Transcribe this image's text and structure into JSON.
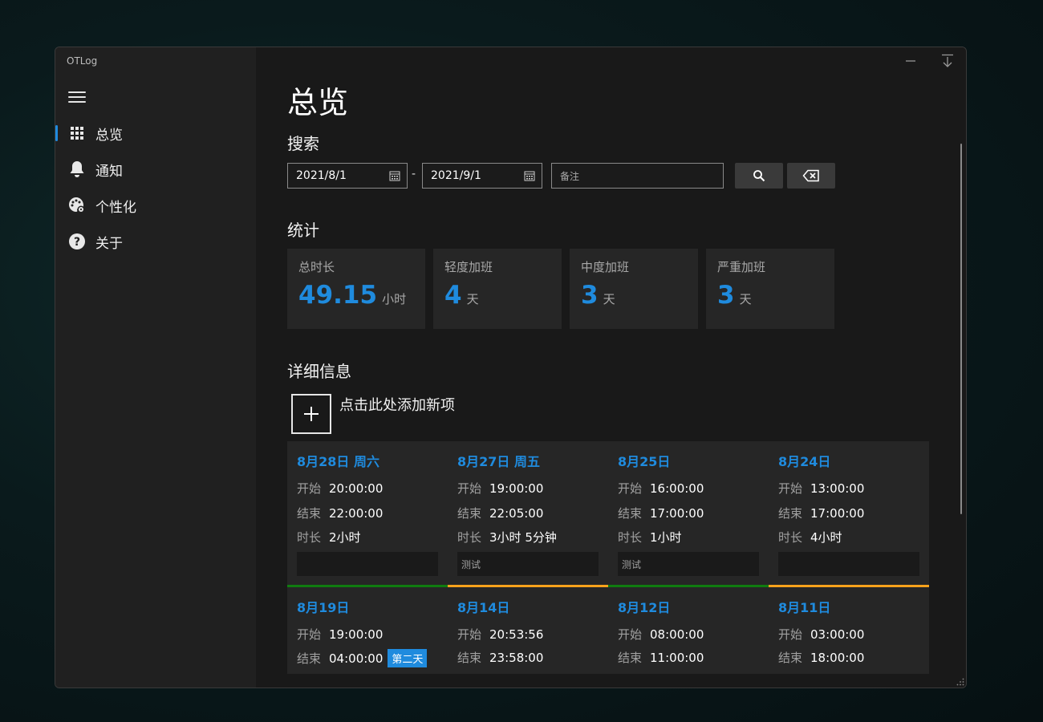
{
  "app": {
    "title": "OTLog"
  },
  "sidebar": {
    "items": [
      {
        "label": "总览",
        "icon": "grid-icon",
        "active": true
      },
      {
        "label": "通知",
        "icon": "bell-icon",
        "active": false
      },
      {
        "label": "个性化",
        "icon": "palette-icon",
        "active": false
      },
      {
        "label": "关于",
        "icon": "help-icon",
        "active": false
      }
    ]
  },
  "page": {
    "title": "总览"
  },
  "search": {
    "title": "搜索",
    "start_date": "2021/8/1",
    "end_date": "2021/9/1",
    "separator": "-",
    "note_placeholder": "备注"
  },
  "stats": {
    "title": "统计",
    "cards": [
      {
        "title": "总时长",
        "value": "49.15",
        "unit": "小时"
      },
      {
        "title": "轻度加班",
        "value": "4",
        "unit": "天"
      },
      {
        "title": "中度加班",
        "value": "3",
        "unit": "天"
      },
      {
        "title": "严重加班",
        "value": "3",
        "unit": "天"
      }
    ]
  },
  "details": {
    "title": "详细信息",
    "add_label": "点击此处添加新项",
    "labels": {
      "start": "开始",
      "end": "结束",
      "duration": "时长"
    },
    "entries": [
      {
        "date": "8月28日 周六",
        "start": "20:00:00",
        "end": "22:00:00",
        "duration": "2小时",
        "note": "",
        "bar_color": "#107c10"
      },
      {
        "date": "8月27日 周五",
        "start": "19:00:00",
        "end": "22:05:00",
        "duration": "3小时 5分钟",
        "note": "测试",
        "bar_color": "#f7a21b"
      },
      {
        "date": "8月25日",
        "start": "16:00:00",
        "end": "17:00:00",
        "duration": "1小时",
        "note": "测试",
        "bar_color": "#107c10"
      },
      {
        "date": "8月24日",
        "start": "13:00:00",
        "end": "17:00:00",
        "duration": "4小时",
        "note": "",
        "bar_color": "#f7a21b"
      },
      {
        "date": "8月19日",
        "start": "19:00:00",
        "end": "04:00:00",
        "badge": "第二天"
      },
      {
        "date": "8月14日",
        "start": "20:53:56",
        "end": "23:58:00"
      },
      {
        "date": "8月12日",
        "start": "08:00:00",
        "end": "11:00:00"
      },
      {
        "date": "8月11日",
        "start": "03:00:00",
        "end": "18:00:00"
      }
    ]
  },
  "colors": {
    "accent": "#1f8bde",
    "light": "#107c10",
    "medium": "#f7a21b"
  }
}
